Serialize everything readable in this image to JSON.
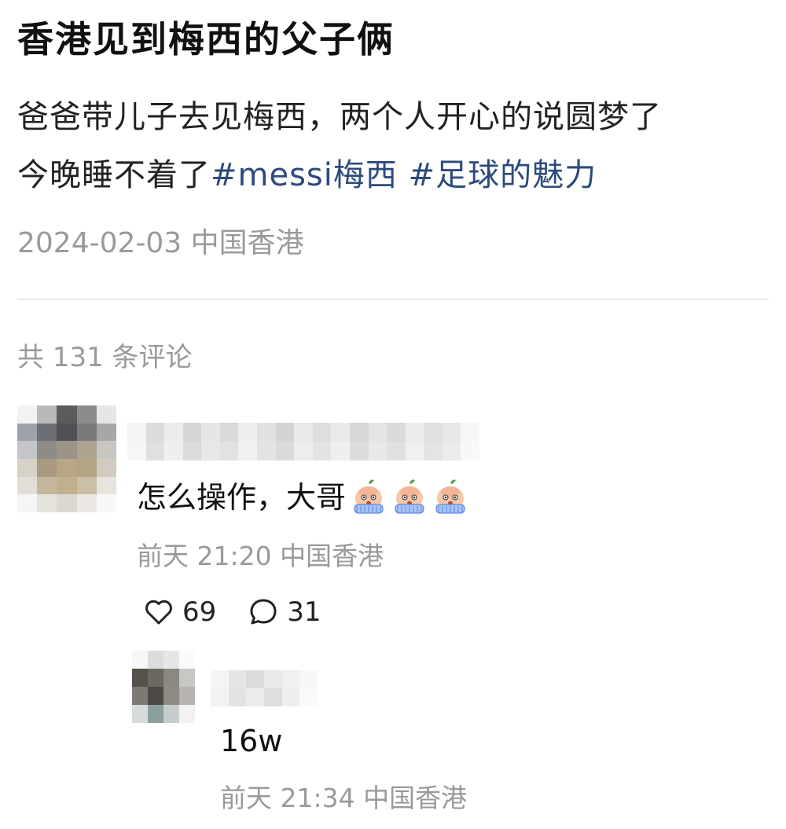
{
  "post": {
    "title": "香港见到梅西的父子俩",
    "body_line1": "爸爸带儿子去见梅西，两个人开心的说圆梦了",
    "body_line2_prefix": "今晚睡不着了",
    "hashtags": [
      "#messi梅西",
      "#足球的魅力"
    ],
    "date": "2024-02-03",
    "location": "中国香港"
  },
  "comments_header": {
    "label": "共 131 条评论"
  },
  "comment": {
    "text": "怎么操作，大哥",
    "emojis": [
      "crying-face-emoji",
      "crying-face-emoji",
      "crying-face-emoji"
    ],
    "time": "前天 21:20",
    "location": "中国香港",
    "likes": "69",
    "replies": "31"
  },
  "reply": {
    "text": "16w",
    "time": "前天 21:34",
    "location": "中国香港"
  },
  "colors": {
    "hashtag": "#2c4a7c",
    "meta_gray": "#9a9a9a",
    "divider": "#e8e8e8"
  },
  "icons": {
    "like": "heart-outline-icon",
    "reply": "speech-bubble-outline-icon"
  }
}
